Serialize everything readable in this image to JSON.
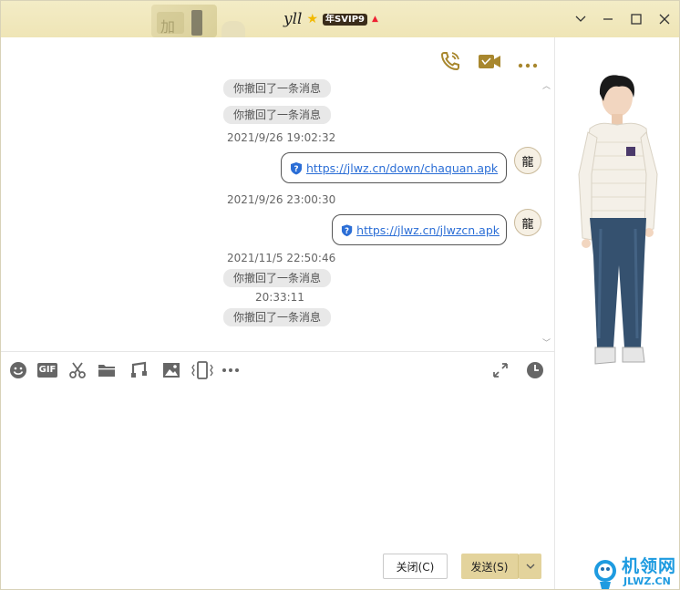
{
  "title": {
    "username": "yll",
    "vip_badge": "年SVIP9"
  },
  "window_controls": [
    "minimize-icon",
    "maximize-icon",
    "close-icon"
  ],
  "chat_top_icons": [
    "phone-icon",
    "video-icon",
    "more-icon"
  ],
  "messages": {
    "m1": "你撤回了一条消息",
    "m2": "你撤回了一条消息",
    "t1": "2021/9/26 19:02:32",
    "link1": "https://jlwz.cn/down/chaquan.apk",
    "t2": "2021/9/26 23:00:30",
    "link2": "https://jlwz.cn/jlwzcn.apk",
    "t3": "2021/11/5 22:50:46",
    "m3": "你撤回了一条消息",
    "t4": "20:33:11",
    "m4": "你撤回了一条消息"
  },
  "avatar_glyph": "龍",
  "toolbar": {
    "gif_label": "GIF",
    "icons": [
      "emoji-icon",
      "gif-icon",
      "scissors-icon",
      "folder-icon",
      "music-icon",
      "image-icon",
      "shake-icon",
      "more-icon",
      "expand-icon",
      "history-clock-icon"
    ]
  },
  "buttons": {
    "close": "关闭(C)",
    "send": "发送(S)"
  },
  "watermark": {
    "cn": "机领网",
    "en": "JLWZ.CN"
  },
  "colors": {
    "titlebar": "#efe5b6",
    "accent_gold": "#a8872e",
    "link": "#2b6ed6",
    "send_button": "#e3d39c"
  }
}
